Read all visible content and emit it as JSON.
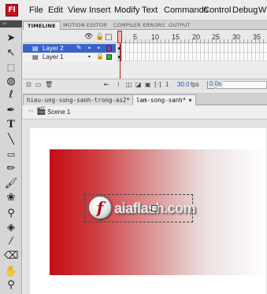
{
  "app": {
    "logo": "Fl"
  },
  "menu": [
    "File",
    "Edit",
    "View",
    "Insert",
    "Modify",
    "Text",
    "Commands",
    "Control",
    "Debug",
    "Wi"
  ],
  "toolbar": {
    "grip": "‹‹"
  },
  "timeline": {
    "tabs": [
      "TIMELINE",
      "MOTION EDITOR",
      "COMPILER ERRORS",
      "OUTPUT"
    ],
    "frame_numbers": [
      "5",
      "10",
      "15",
      "20",
      "25",
      "30",
      "35"
    ],
    "header_icons": {
      "eye": "eye-icon",
      "lock": "lock-icon",
      "outline": "outline-icon"
    },
    "layers": [
      {
        "name": "Layer 2",
        "selected": true,
        "color": "#9b2fd1"
      },
      {
        "name": "Layer 1",
        "selected": false,
        "color": "#22c322"
      }
    ],
    "footer": {
      "frame": "1",
      "fps": "30.0",
      "fps_unit": "fps",
      "time": "0.0s"
    }
  },
  "documents": {
    "tabs": [
      {
        "label": "hieu-ung-song-sanh-trong-as2*",
        "active": false
      },
      {
        "label": "lam-song-sanh*",
        "active": true
      }
    ],
    "close": "×"
  },
  "editbar": {
    "scene": "Scene 1"
  },
  "stage": {
    "gradient": {
      "from": "#c40c14",
      "to": "#ffffff"
    },
    "logo_glyph": "f",
    "brand": "aiaflash.com"
  }
}
